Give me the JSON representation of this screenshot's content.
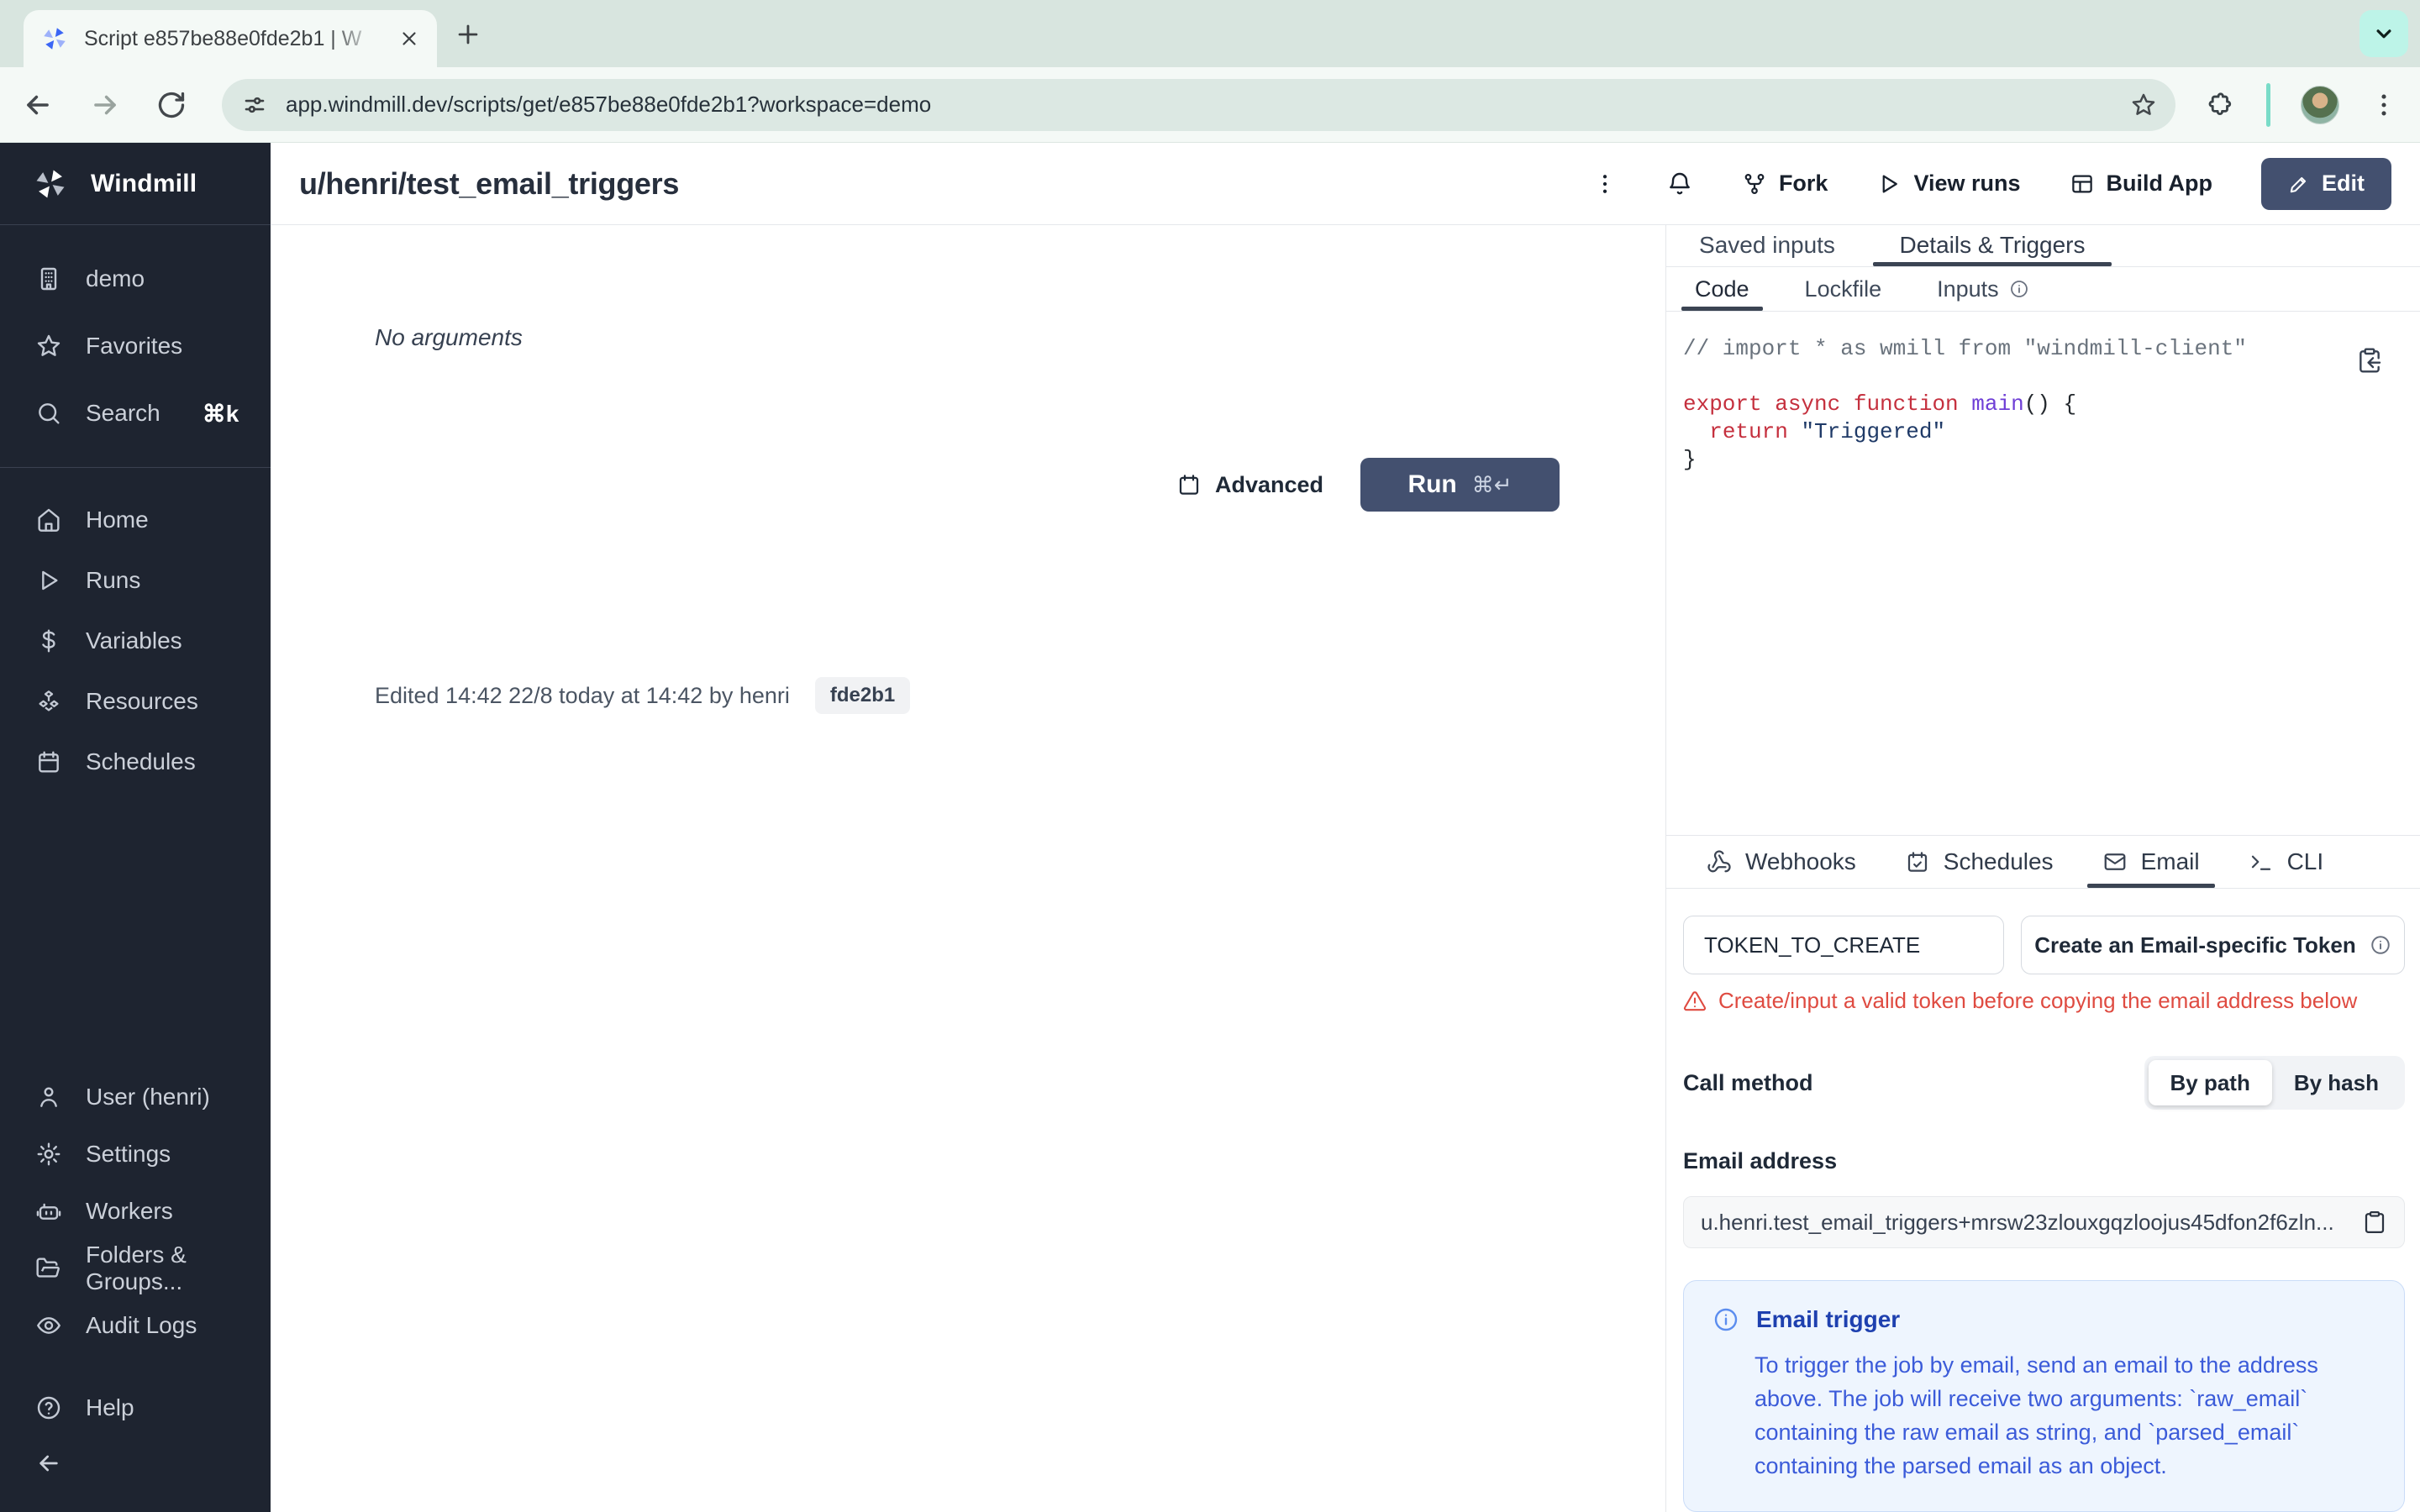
{
  "colors": {
    "accent_navy": "#43506f",
    "warning_red": "#df4b41",
    "info_blue": "#3b5bd9",
    "chrome_mint": "#bdf4e8",
    "sidebar_bg": "#1e2430"
  },
  "browser": {
    "tab_title": "Script e857be88e0fde2b1 | W",
    "url": "app.windmill.dev/scripts/get/e857be88e0fde2b1?workspace=demo"
  },
  "sidebar": {
    "brand": "Windmill",
    "workspace_group": [
      {
        "label": "demo"
      },
      {
        "label": "Favorites"
      },
      {
        "label": "Search",
        "shortcut": "⌘k"
      }
    ],
    "nav_group": [
      {
        "label": "Home"
      },
      {
        "label": "Runs"
      },
      {
        "label": "Variables"
      },
      {
        "label": "Resources"
      },
      {
        "label": "Schedules"
      }
    ],
    "admin_group": [
      {
        "label": "User (henri)"
      },
      {
        "label": "Settings"
      },
      {
        "label": "Workers"
      },
      {
        "label": "Folders & Groups..."
      },
      {
        "label": "Audit Logs"
      }
    ],
    "help_label": "Help"
  },
  "header": {
    "title": "u/henri/test_email_triggers",
    "fork": "Fork",
    "view_runs": "View runs",
    "build_app": "Build App",
    "edit": "Edit"
  },
  "main": {
    "no_arguments": "No arguments",
    "advanced": "Advanced",
    "run": "Run",
    "run_shortcut": "⌘↵",
    "edited": "Edited 14:42 22/8 today at 14:42 by henri",
    "version_badge": "fde2b1"
  },
  "details": {
    "tabs": [
      {
        "label": "Saved inputs"
      },
      {
        "label": "Details & Triggers"
      }
    ],
    "subtabs": [
      {
        "label": "Code"
      },
      {
        "label": "Lockfile"
      },
      {
        "label": "Inputs"
      }
    ],
    "code": {
      "comment": "// import * as wmill from \"windmill-client\"",
      "kw_export": "export ",
      "kw_async": "async ",
      "kw_function": "function ",
      "fn_main": "main",
      "punct_open": "() {",
      "indent": "  ",
      "kw_return": "return ",
      "str_value": "\"Triggered\"",
      "punct_close": "}"
    },
    "trigger_tabs": [
      {
        "label": "Webhooks"
      },
      {
        "label": "Schedules"
      },
      {
        "label": "Email"
      },
      {
        "label": "CLI"
      }
    ],
    "email": {
      "token_value": "TOKEN_TO_CREATE",
      "create_token": "Create an Email-specific Token",
      "warning": "Create/input a valid token before copying the email address below",
      "call_method": "Call method",
      "by_path": "By path",
      "by_hash": "By hash",
      "address_label": "Email address",
      "address_value": "u.henri.test_email_triggers+mrsw23zlouxgqzloojus45dfon2f6zln...",
      "info_title": "Email trigger",
      "info_body": "To trigger the job by email, send an email to the address above. The job will receive two arguments: `raw_email` containing the raw email as string, and `parsed_email` containing the parsed email as an object."
    }
  }
}
